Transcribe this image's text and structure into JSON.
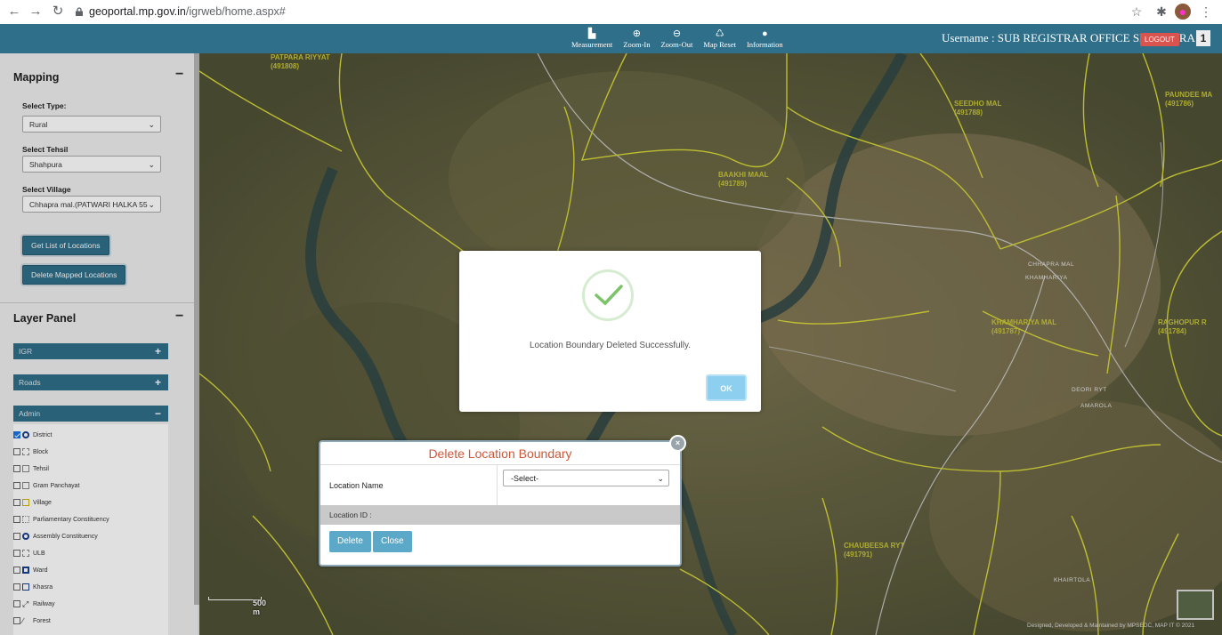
{
  "browser": {
    "url_domain": "geoportal.mp.gov.in",
    "url_path": "/igrweb/home.aspx#"
  },
  "header": {
    "tools": [
      {
        "label": "Measurement",
        "icon": "ruler-icon"
      },
      {
        "label": "Zoom-In",
        "icon": "zoom-in-icon"
      },
      {
        "label": "Zoom-Out",
        "icon": "zoom-out-icon"
      },
      {
        "label": "Map Reset",
        "icon": "recycle-icon"
      },
      {
        "label": "Information",
        "icon": "info-icon"
      }
    ],
    "username": "Username : SUB REGISTRAR OFFICE SHAHPURA",
    "logout_label": "LOGOUT",
    "exit_label": "1"
  },
  "sidebar": {
    "mapping_title": "Mapping",
    "select_type_label": "Select Type:",
    "select_type_value": "Rural",
    "select_tehsil_label": "Select Tehsil",
    "select_tehsil_value": "Shahpura",
    "select_village_label": "Select Village",
    "select_village_value": "Chhapra mal.(PATWARI HALKA 55",
    "get_list_label": "Get List of Locations",
    "delete_mapped_label": "Delete Mapped Locations",
    "layer_panel_title": "Layer Panel",
    "layer_groups": [
      {
        "label": "IGR",
        "toggle": "+"
      },
      {
        "label": "Roads",
        "toggle": "+"
      },
      {
        "label": "Admin",
        "toggle": "−"
      }
    ],
    "admin_layers": [
      {
        "label": "District",
        "checked": true,
        "color": "#1a3f8a"
      },
      {
        "label": "Block",
        "checked": false,
        "color": "#888888"
      },
      {
        "label": "Tehsil",
        "checked": false,
        "color": "#888888"
      },
      {
        "label": "Gram Panchayat",
        "checked": false,
        "color": "#888888"
      },
      {
        "label": "Village",
        "checked": false,
        "color": "#c9b400"
      },
      {
        "label": "Parliamentary Constituency",
        "checked": false,
        "color": "#888888"
      },
      {
        "label": "Assembly Constituency",
        "checked": false,
        "color": "#1a3f8a"
      },
      {
        "label": "ULB",
        "checked": false,
        "color": "#888888"
      },
      {
        "label": "Ward",
        "checked": false,
        "color": "#1a3f8a"
      },
      {
        "label": "Khasra",
        "checked": false,
        "color": "#1a3f8a"
      },
      {
        "label": "Railway",
        "checked": false,
        "color": "#333333"
      },
      {
        "label": "Forest",
        "checked": false,
        "color": "#333333"
      }
    ]
  },
  "map": {
    "village_labels": [
      {
        "name": "PATPARA RIYYAT",
        "code": "(491808)"
      },
      {
        "name": "SEEDHO MAL",
        "code": "(491788)"
      },
      {
        "name": "PAUNDEE MA",
        "code": "(491786)"
      },
      {
        "name": "BAAKHI MAAL",
        "code": "(491789)"
      },
      {
        "name": "KHAMHARIYA MAL",
        "code": "(491787)"
      },
      {
        "name": "RAGHOPUR R",
        "code": "(491784)"
      },
      {
        "name": "CHAUBEESA RYT",
        "code": "(491791)"
      }
    ],
    "place_labels": [
      "CHHAPRA MAL",
      "KHAMHARIYA",
      "DEORI RYT",
      "AMAROLA",
      "KHAIRTOLA"
    ],
    "scale_label": "500 m",
    "attribution": "Designed, Developed & Maintained by MPSEDC, MAP IT © 2021"
  },
  "delete_panel": {
    "title": "Delete Location Boundary",
    "location_name_label": "Location Name",
    "location_select_value": "-Select-",
    "location_id_label": "Location ID :",
    "delete_label": "Delete",
    "close_label": "Close"
  },
  "modal": {
    "message": "Location Boundary Deleted Successfully.",
    "ok_label": "OK",
    "accent_color": "#8ccfee",
    "check_color": "#7cc36a"
  }
}
